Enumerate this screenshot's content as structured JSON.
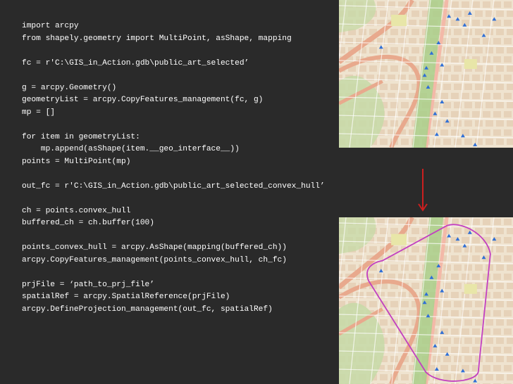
{
  "code_lines": [
    "import arcpy",
    "from shapely.geometry import MultiPoint, asShape, mapping",
    "",
    "fc = r'C:\\GIS_in_Action.gdb\\public_art_selected’",
    "",
    "g = arcpy.Geometry()",
    "geometryList = arcpy.CopyFeatures_management(fc, g)",
    "mp = []",
    "",
    "for item in geometryList:",
    "    mp.append(asShape(item.__geo_interface__))",
    "points = MultiPoint(mp)",
    "",
    "out_fc = r'C:\\GIS_in_Action.gdb\\public_art_selected_convex_hull’",
    "",
    "ch = points.convex_hull",
    "buffered_ch = ch.buffer(100)",
    "",
    "points_convex_hull = arcpy.AsShape(mapping(buffered_ch))",
    "arcpy.CopyFeatures_management(points_convex_hull, ch_fc)",
    "",
    "prjFile = ‘path_to_prj_file’",
    "spatialRef = arcpy.SpatialReference(prjFile)",
    "arcpy.DefineProjection_management(out_fc, spatialRef)"
  ],
  "colors": {
    "background": "#2a2a2a",
    "code_text": "#ffffff",
    "arrow": "#cc1f1f",
    "hull": "#c23fc0",
    "art_point": "#2f6fd6",
    "park": "#a9cf8a",
    "freeway": "#e8a98d"
  },
  "icons": [
    "art-point-icon",
    "down-arrow-icon"
  ],
  "map_points": [
    [
      0.62,
      0.12
    ],
    [
      0.67,
      0.14
    ],
    [
      0.71,
      0.18
    ],
    [
      0.56,
      0.3
    ],
    [
      0.52,
      0.37
    ],
    [
      0.58,
      0.45
    ],
    [
      0.49,
      0.47
    ],
    [
      0.5,
      0.6
    ],
    [
      0.58,
      0.7
    ],
    [
      0.61,
      0.83
    ],
    [
      0.55,
      0.92
    ],
    [
      0.7,
      0.93
    ],
    [
      0.77,
      0.99
    ],
    [
      0.82,
      0.25
    ],
    [
      0.74,
      0.1
    ],
    [
      0.88,
      0.14
    ],
    [
      0.23,
      0.33
    ],
    [
      0.48,
      0.52
    ],
    [
      0.54,
      0.78
    ]
  ]
}
